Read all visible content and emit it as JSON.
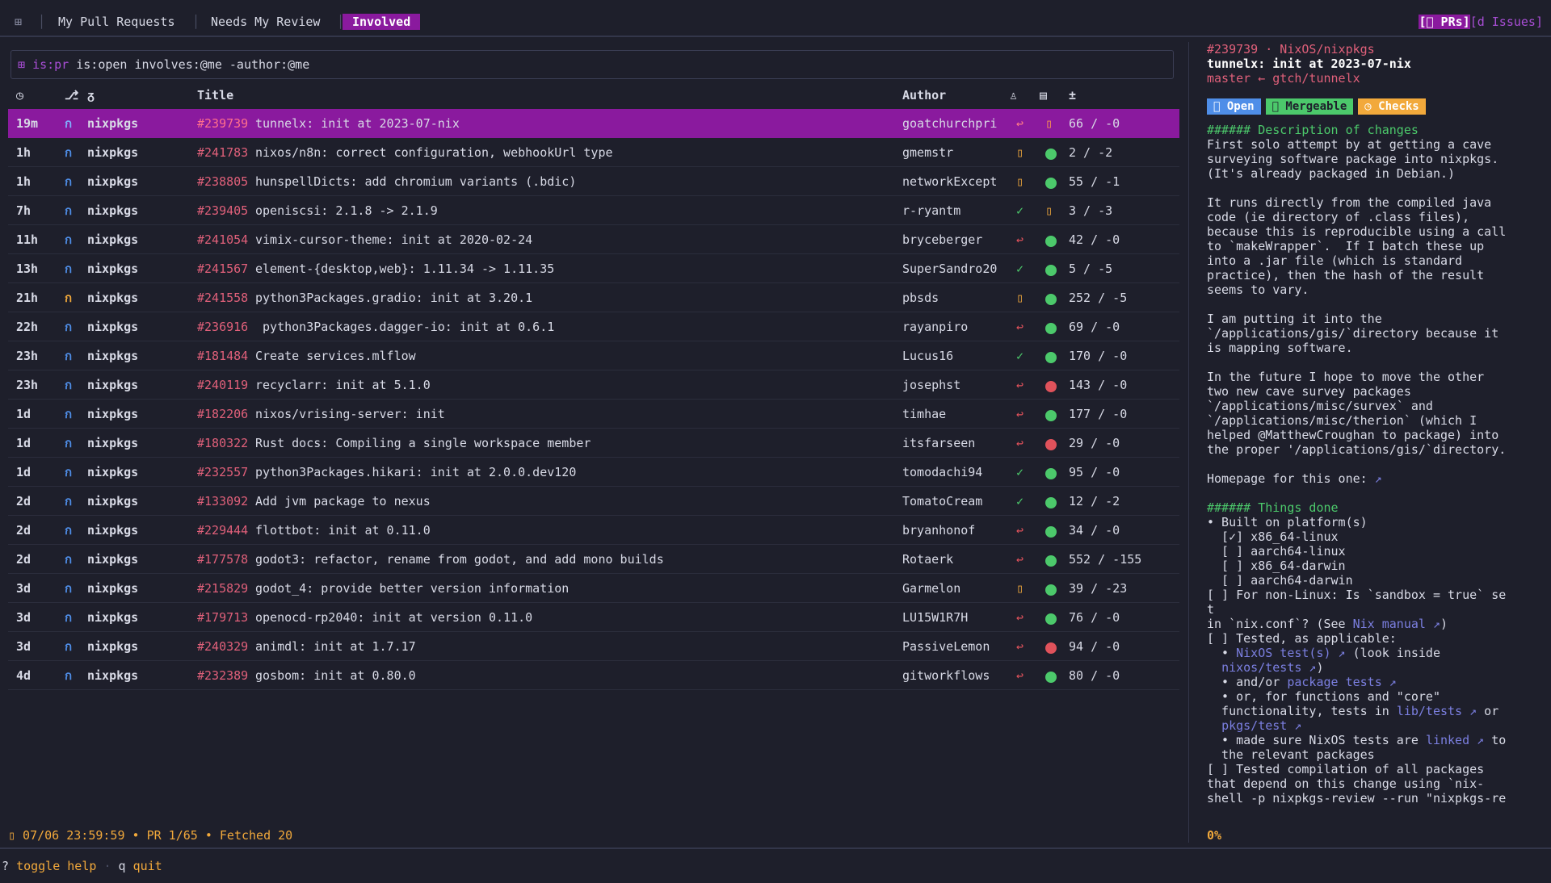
{
  "tabs": {
    "icon": "⊞",
    "items": [
      "My Pull Requests",
      "Needs My Review",
      "Involved"
    ],
    "active": 2,
    "mode_prs": "[󰊢 PRs]",
    "mode_issues": "[d Issues]"
  },
  "search": {
    "prefix": "is:pr",
    "query": "is:open involves:@me -author:@me"
  },
  "columns": {
    "title": "Title",
    "author": "Author"
  },
  "rows": [
    {
      "age": "19m",
      "repo": "nixpkgs",
      "number": "#239739",
      "title": "tunnelx: init at 2023-07-nix",
      "author": "goatchurchpri",
      "review": "↩",
      "ci": "pending",
      "lines": "66 / -0"
    },
    {
      "age": "1h",
      "repo": "nixpkgs",
      "number": "#241783",
      "title": "nixos/n8n: correct configuration, webhookUrl type",
      "author": "gmemstr",
      "review": "▯",
      "ci": "ok",
      "lines": "2 / -2"
    },
    {
      "age": "1h",
      "repo": "nixpkgs",
      "number": "#238805",
      "title": "hunspellDicts: add chromium variants (.bdic)",
      "author": "networkExcept",
      "review": "▯",
      "ci": "ok",
      "lines": "55 / -1"
    },
    {
      "age": "7h",
      "repo": "nixpkgs",
      "number": "#239405",
      "title": "openiscsi: 2.1.8 -> 2.1.9",
      "author": "r-ryantm",
      "review": "✓",
      "ci": "pending",
      "lines": "3 / -3"
    },
    {
      "age": "11h",
      "repo": "nixpkgs",
      "number": "#241054",
      "title": "vimix-cursor-theme: init at 2020-02-24",
      "author": "bryceberger",
      "review": "↩",
      "ci": "ok",
      "lines": "42 / -0"
    },
    {
      "age": "13h",
      "repo": "nixpkgs",
      "number": "#241567",
      "title": "element-{desktop,web}: 1.11.34 -> 1.11.35",
      "author": "SuperSandro20",
      "review": "✓",
      "ci": "ok",
      "lines": "5 / -5"
    },
    {
      "age": "21h",
      "repo": "nixpkgs",
      "number": "#241558",
      "title": "python3Packages.gradio: init at 3.20.1",
      "author": "pbsds",
      "review": "▯",
      "ci": "ok",
      "lines": "252 / -5",
      "draft": true
    },
    {
      "age": "22h",
      "repo": "nixpkgs",
      "number": "#236916",
      "title": " python3Packages.dagger-io: init at 0.6.1",
      "author": "rayanpiro",
      "review": "↩",
      "ci": "ok",
      "lines": "69 / -0"
    },
    {
      "age": "23h",
      "repo": "nixpkgs",
      "number": "#181484",
      "title": "Create services.mlflow",
      "author": "Lucus16",
      "review": "✓",
      "ci": "ok",
      "lines": "170 / -0"
    },
    {
      "age": "23h",
      "repo": "nixpkgs",
      "number": "#240119",
      "title": "recyclarr: init at 5.1.0",
      "author": "josephst",
      "review": "↩",
      "ci": "fail",
      "lines": "143 / -0"
    },
    {
      "age": "1d",
      "repo": "nixpkgs",
      "number": "#182206",
      "title": "nixos/vrising-server: init",
      "author": "timhae",
      "review": "↩",
      "ci": "ok",
      "lines": "177 / -0"
    },
    {
      "age": "1d",
      "repo": "nixpkgs",
      "number": "#180322",
      "title": "Rust docs: Compiling a single workspace member",
      "author": "itsfarseen",
      "review": "↩",
      "ci": "fail",
      "lines": "29 / -0"
    },
    {
      "age": "1d",
      "repo": "nixpkgs",
      "number": "#232557",
      "title": "python3Packages.hikari: init at 2.0.0.dev120",
      "author": "tomodachi94",
      "review": "✓",
      "ci": "ok",
      "lines": "95 / -0"
    },
    {
      "age": "2d",
      "repo": "nixpkgs",
      "number": "#133092",
      "title": "Add jvm package to nexus",
      "author": "TomatoCream",
      "review": "✓",
      "ci": "ok",
      "lines": "12 / -2"
    },
    {
      "age": "2d",
      "repo": "nixpkgs",
      "number": "#229444",
      "title": "flottbot: init at 0.11.0",
      "author": "bryanhonof",
      "review": "↩",
      "ci": "ok",
      "lines": "34 / -0"
    },
    {
      "age": "2d",
      "repo": "nixpkgs",
      "number": "#177578",
      "title": "godot3: refactor, rename from godot, and add mono builds",
      "author": "Rotaerk",
      "review": "↩",
      "ci": "ok",
      "lines": "552 / -155"
    },
    {
      "age": "3d",
      "repo": "nixpkgs",
      "number": "#215829",
      "title": "godot_4: provide better version information",
      "author": "Garmelon",
      "review": "▯",
      "ci": "ok",
      "lines": "39 / -23"
    },
    {
      "age": "3d",
      "repo": "nixpkgs",
      "number": "#179713",
      "title": "openocd-rp2040: init at version 0.11.0",
      "author": "LU15W1R7H",
      "review": "↩",
      "ci": "ok",
      "lines": "76 / -0"
    },
    {
      "age": "3d",
      "repo": "nixpkgs",
      "number": "#240329",
      "title": "animdl: init at 1.7.17",
      "author": "PassiveLemon",
      "review": "↩",
      "ci": "fail",
      "lines": "94 / -0"
    },
    {
      "age": "4d",
      "repo": "nixpkgs",
      "number": "#232389",
      "title": "gosbom: init at 0.80.0",
      "author": "gitworkflows",
      "review": "↩",
      "ci": "ok",
      "lines": "80 / -0"
    }
  ],
  "sidebar": {
    "header": "#239739 · NixOS/nixpkgs",
    "title": "tunnelx: init at 2023-07-nix",
    "branch": "master ← gtch/tunnelx",
    "badges": {
      "open": "󰘬 Open",
      "mergeable": "󰘭 Mergeable",
      "checks": "◷ Checks"
    },
    "lines": [
      {
        "t": "###### Description of changes",
        "c": "green"
      },
      {
        "t": "First solo attempt by at getting a cave"
      },
      {
        "t": "surveying software package into nixpkgs."
      },
      {
        "t": "(It's already packaged in Debian.)"
      },
      {
        "t": ""
      },
      {
        "t": "It runs directly from the compiled java"
      },
      {
        "t": "code (ie directory of .class files),"
      },
      {
        "t": "because this is reproducible using a call"
      },
      {
        "t": "to `makeWrapper`.  If I batch these up"
      },
      {
        "t": "into a .jar file (which is standard"
      },
      {
        "t": "practice), then the hash of the result"
      },
      {
        "t": "seems to vary."
      },
      {
        "t": ""
      },
      {
        "t": "I am putting it into the"
      },
      {
        "t": "`/applications/gis/`directory because it"
      },
      {
        "t": "is mapping software."
      },
      {
        "t": ""
      },
      {
        "t": "In the future I hope to move the other"
      },
      {
        "t": "two new cave survey packages"
      },
      {
        "t": "`/applications/misc/survex` and"
      },
      {
        "t": "`/applications/misc/therion` (which I"
      },
      {
        "t": "helped @MatthewCroughan to package) into"
      },
      {
        "t": "the proper '/applications/gis/`directory."
      },
      {
        "t": ""
      },
      {
        "t": "Homepage for this one: ",
        "link": "↗"
      },
      {
        "t": ""
      },
      {
        "t": "###### Things done",
        "c": "green"
      },
      {
        "t": "• Built on platform(s)"
      },
      {
        "t": "  [✓] x86_64-linux"
      },
      {
        "t": "  [ ] aarch64-linux"
      },
      {
        "t": "  [ ] x86_64-darwin"
      },
      {
        "t": "  [ ] aarch64-darwin"
      },
      {
        "t": "[ ] For non-Linux: Is `sandbox = true` se"
      },
      {
        "t": "t"
      },
      {
        "t": "in `nix.conf`? (See ",
        "link": "Nix manual ↗",
        "after": ")"
      },
      {
        "t": "[ ] Tested, as applicable:"
      },
      {
        "t": "  • ",
        "link": "NixOS test(s) ↗",
        "after": " (look inside"
      },
      {
        "t": "  ",
        "link": "nixos/tests ↗",
        "after": ")"
      },
      {
        "t": "  • and/or ",
        "link": "package tests ↗"
      },
      {
        "t": "  • or, for functions and \"core\""
      },
      {
        "t": "  functionality, tests in ",
        "link": "lib/tests ↗",
        "after": " or"
      },
      {
        "t": "  ",
        "link": "pkgs/test ↗"
      },
      {
        "t": "  • made sure NixOS tests are ",
        "link": "linked ↗",
        "after": " to"
      },
      {
        "t": "  the relevant packages"
      },
      {
        "t": "[ ] Tested compilation of all packages"
      },
      {
        "t": "that depend on this change using `nix-"
      },
      {
        "t": "shell -p nixpkgs-review --run \"nixpkgs-re"
      }
    ],
    "percent": "0%"
  },
  "status": "▯ 07/06 23:59:59 • PR 1/65 • Fetched 20",
  "footer": {
    "help_key": "?",
    "help_label": "toggle help",
    "sep": "·",
    "quit_key": "q",
    "quit_label": "quit"
  },
  "colors": {
    "accent": "#8a1a9e",
    "ok": "#4cc96b",
    "fail": "#e0525b",
    "warn": "#f2a93b",
    "pr_open": "#4f8ee8",
    "pr_draft": "#f2a93b"
  }
}
